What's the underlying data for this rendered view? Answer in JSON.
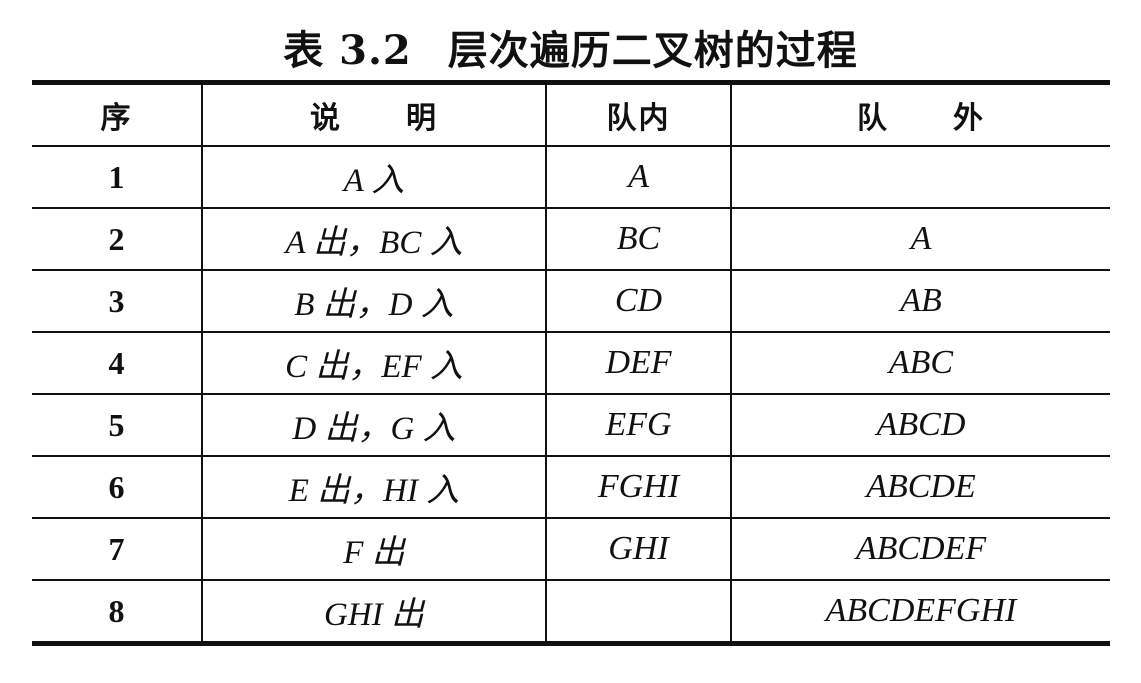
{
  "caption": {
    "number": "表 3.2",
    "title": "层次遍历二叉树的过程"
  },
  "table": {
    "headers": [
      "序",
      "说　　明",
      "队内",
      "队　　外"
    ],
    "rows": [
      {
        "seq": "1",
        "desc": "A 入",
        "in": "A",
        "out": ""
      },
      {
        "seq": "2",
        "desc": "A 出，BC 入",
        "in": "BC",
        "out": "A"
      },
      {
        "seq": "3",
        "desc": "B 出，D 入",
        "in": "CD",
        "out": "AB"
      },
      {
        "seq": "4",
        "desc": "C 出，EF 入",
        "in": "DEF",
        "out": "ABC"
      },
      {
        "seq": "5",
        "desc": "D 出，G 入",
        "in": "EFG",
        "out": "ABCD"
      },
      {
        "seq": "6",
        "desc": "E 出，HI 入",
        "in": "FGHI",
        "out": "ABCDE"
      },
      {
        "seq": "7",
        "desc": "F 出",
        "in": "GHI",
        "out": "ABCDEF"
      },
      {
        "seq": "8",
        "desc": "GHI 出",
        "in": "",
        "out": "ABCDEFGHI"
      }
    ]
  }
}
